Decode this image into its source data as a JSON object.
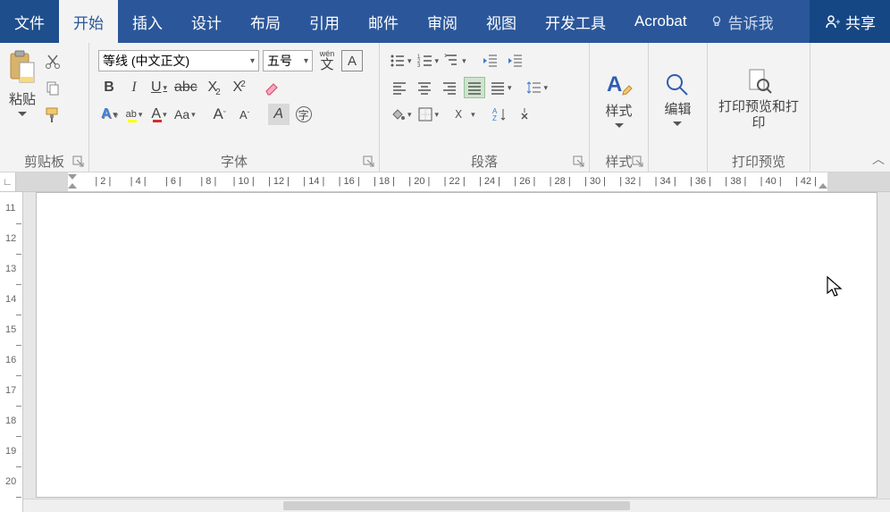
{
  "tabs": {
    "file": "文件",
    "home": "开始",
    "insert": "插入",
    "design": "设计",
    "layout": "布局",
    "references": "引用",
    "mailings": "邮件",
    "review": "审阅",
    "view": "视图",
    "developer": "开发工具",
    "acrobat": "Acrobat"
  },
  "tellme": {
    "placeholder": "告诉我"
  },
  "share": {
    "label": "共享"
  },
  "clipboard": {
    "paste": "粘贴",
    "group_label": "剪贴板"
  },
  "font": {
    "name": "等线 (中文正文)",
    "size": "五号",
    "pinyin_label": "wén",
    "group_label": "字体"
  },
  "paragraph": {
    "group_label": "段落"
  },
  "styles": {
    "button": "样式",
    "group_label": "样式"
  },
  "editing": {
    "button": "编辑"
  },
  "preview": {
    "button": "打印预览和打印",
    "group_label": "打印预览"
  },
  "ruler_h": {
    "marks": [
      2,
      4,
      6,
      8,
      10,
      12,
      14,
      16,
      18,
      20,
      22,
      24,
      26,
      28,
      30,
      32,
      34,
      36,
      38,
      40,
      42
    ]
  },
  "ruler_v": {
    "marks": [
      11,
      12,
      13,
      14,
      15,
      16,
      17,
      18,
      19,
      20
    ]
  }
}
